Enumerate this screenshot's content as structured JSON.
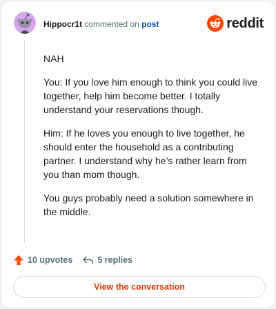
{
  "comment": {
    "author": "Hippocr1t",
    "action_text": "commented on",
    "post_link": "post",
    "paragraphs": [
      "NAH",
      "You: If you love him enough to think you could live together, help him become better. I totally understand your reservations though.",
      "Him: If he loves you enough to live together, he should enter the household as a contributing partner. I understand why he’s rather learn from you than mom though.",
      "You guys probably need a solution somewhere in the middle."
    ]
  },
  "brand": {
    "wordmark": "reddit",
    "icon": "reddit-snoo-icon",
    "color": "#ff4500"
  },
  "avatar": {
    "icon": "snoo-avatar-icon",
    "color": "#d4a7ec"
  },
  "footer": {
    "upvotes": "10 upvotes",
    "upvote_icon": "upvote-arrow-icon",
    "upvote_color": "#ff4500",
    "replies": "5 replies",
    "reply_icon": "reply-arrow-icon"
  },
  "cta": {
    "label": "View the conversation",
    "color": "#d93a00"
  }
}
